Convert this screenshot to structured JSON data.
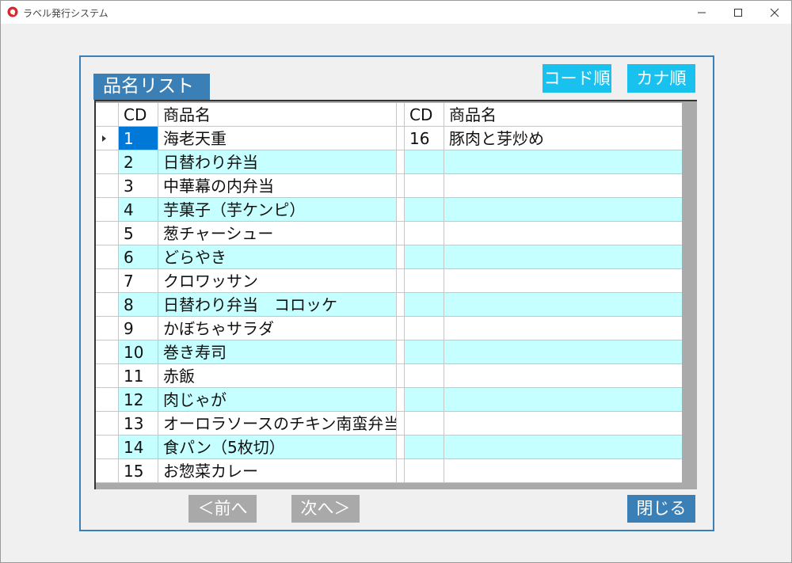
{
  "window": {
    "title": "ラベル発行システム"
  },
  "panel": {
    "list_title": "品名リスト",
    "sort_code_label": "コード順",
    "sort_kana_label": "カナ順",
    "prev_label": "＜前へ",
    "next_label": "次へ＞",
    "close_label": "閉じる"
  },
  "grid": {
    "headers": {
      "cd1": "CD",
      "name1": "商品名",
      "cd2": "CD",
      "name2": "商品名"
    },
    "rows": [
      {
        "cd1": "1",
        "name1": "海老天重",
        "cd2": "16",
        "name2": "豚肉と芽炒め"
      },
      {
        "cd1": "2",
        "name1": "日替わり弁当",
        "cd2": "",
        "name2": ""
      },
      {
        "cd1": "3",
        "name1": "中華幕の内弁当",
        "cd2": "",
        "name2": ""
      },
      {
        "cd1": "4",
        "name1": "芋菓子（芋ケンピ）",
        "cd2": "",
        "name2": ""
      },
      {
        "cd1": "5",
        "name1": "葱チャーシュー",
        "cd2": "",
        "name2": ""
      },
      {
        "cd1": "6",
        "name1": "どらやき",
        "cd2": "",
        "name2": ""
      },
      {
        "cd1": "7",
        "name1": "クロワッサン",
        "cd2": "",
        "name2": ""
      },
      {
        "cd1": "8",
        "name1": "日替わり弁当　コロッケ",
        "cd2": "",
        "name2": ""
      },
      {
        "cd1": "9",
        "name1": "かぼちゃサラダ",
        "cd2": "",
        "name2": ""
      },
      {
        "cd1": "10",
        "name1": "巻き寿司",
        "cd2": "",
        "name2": ""
      },
      {
        "cd1": "11",
        "name1": "赤飯",
        "cd2": "",
        "name2": ""
      },
      {
        "cd1": "12",
        "name1": "肉じゃが",
        "cd2": "",
        "name2": ""
      },
      {
        "cd1": "13",
        "name1": "オーロラソースのチキン南蛮弁当",
        "cd2": "",
        "name2": ""
      },
      {
        "cd1": "14",
        "name1": "食パン（5枚切）",
        "cd2": "",
        "name2": ""
      },
      {
        "cd1": "15",
        "name1": "お惣菜カレー",
        "cd2": "",
        "name2": ""
      }
    ]
  },
  "colors": {
    "accent": "#3a7fb5",
    "sort_button": "#19c1ef",
    "row_highlight": "#c6ffff",
    "selection": "#0078d7",
    "disabled_button": "#a9a9a9"
  }
}
